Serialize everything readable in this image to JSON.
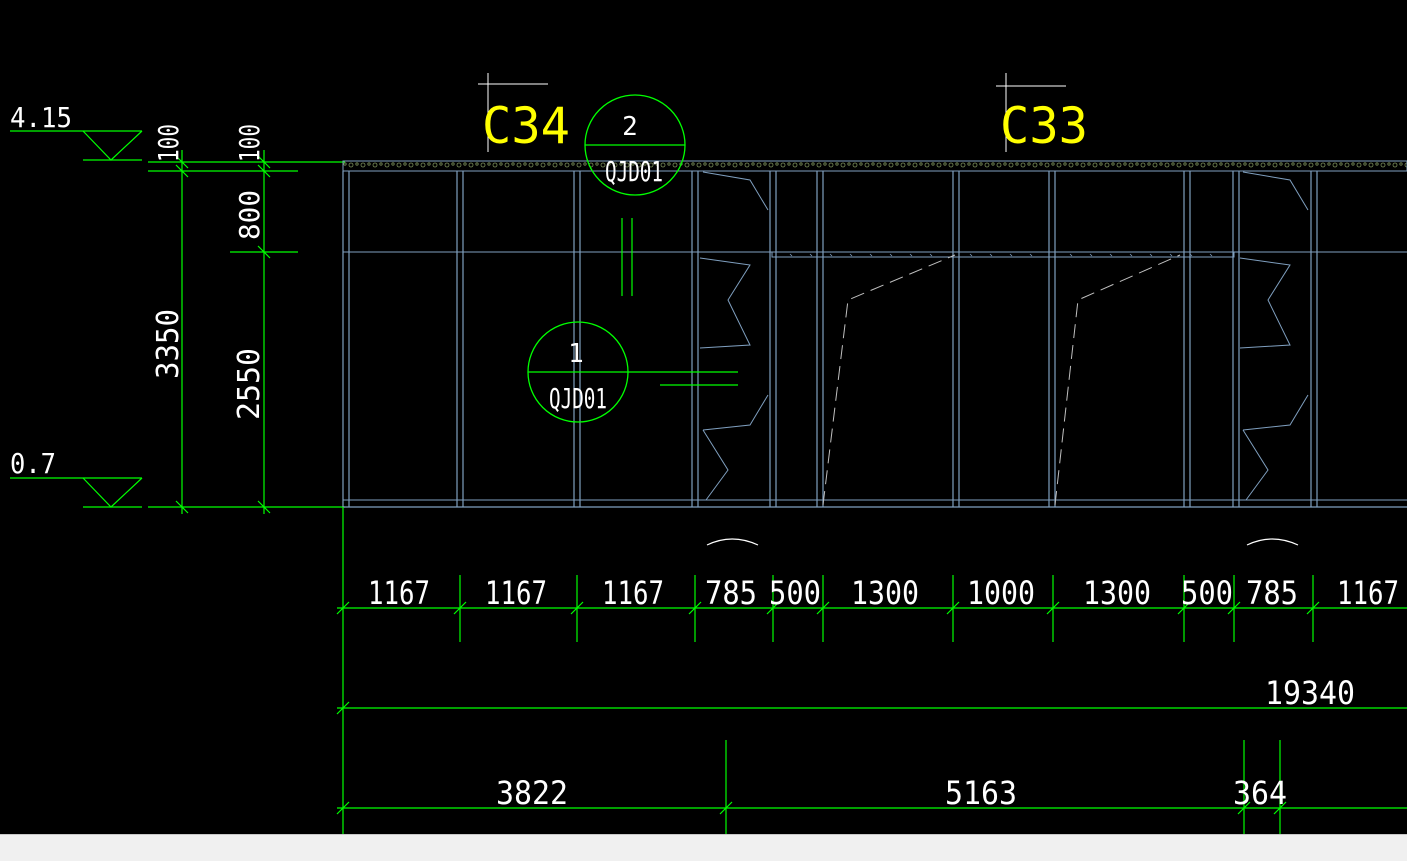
{
  "colors": {
    "background": "#000000",
    "dimension": "#00ff00",
    "wall": "#7f9fbf",
    "grid_label": "#ffff00",
    "text": "#ffffff"
  },
  "elevations": {
    "top": "4.15",
    "bottom": "0.7"
  },
  "vertical_dims": {
    "overall": "3350",
    "top_a": "100",
    "top_b": "100",
    "mid": "800",
    "lower": "2550"
  },
  "grid_labels": {
    "left": "C34",
    "right": "C33"
  },
  "detail_markers": [
    {
      "number": "2",
      "ref": "QJD01"
    },
    {
      "number": "1",
      "ref": "QJD01"
    }
  ],
  "dim_row1": [
    "1167",
    "1167",
    "1167",
    "785",
    "500",
    "1300",
    "1000",
    "1300",
    "500",
    "785",
    "1167"
  ],
  "dim_row2": [
    "19340"
  ],
  "dim_row3": [
    "3822",
    "5163",
    "364"
  ]
}
